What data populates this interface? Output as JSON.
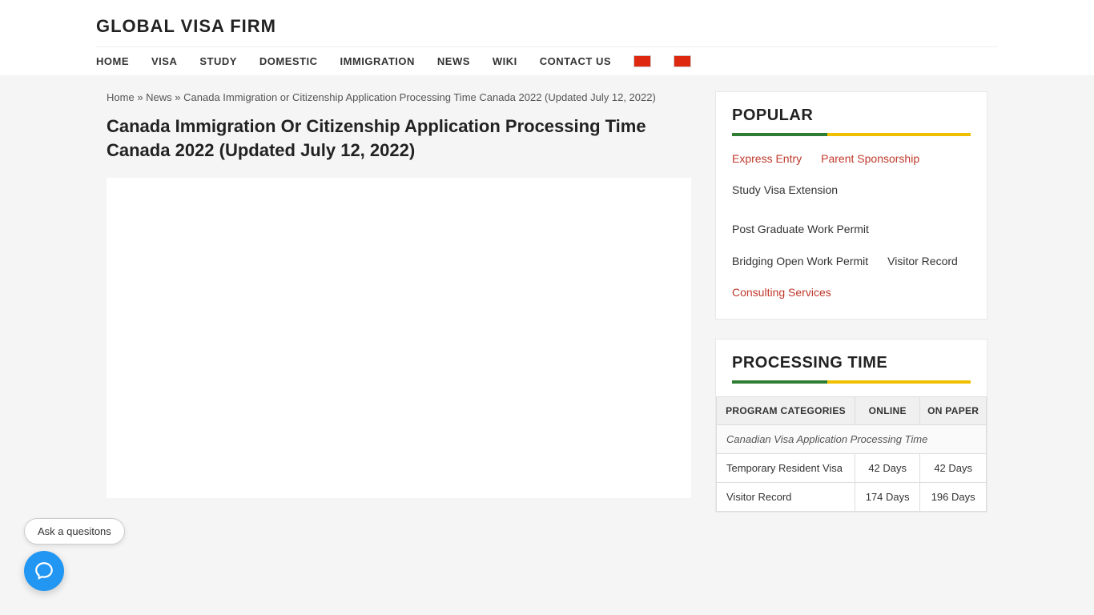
{
  "site": {
    "title": "GLOBAL VISA FIRM"
  },
  "nav": {
    "items": [
      {
        "label": "HOME",
        "href": "#"
      },
      {
        "label": "VISA",
        "href": "#"
      },
      {
        "label": "STUDY",
        "href": "#"
      },
      {
        "label": "DOMESTIC",
        "href": "#"
      },
      {
        "label": "IMMIGRATION",
        "href": "#"
      },
      {
        "label": "NEWS",
        "href": "#"
      },
      {
        "label": "WIKI",
        "href": "#"
      },
      {
        "label": "CONTACT US",
        "href": "#"
      }
    ]
  },
  "breadcrumb": {
    "home": "Home",
    "news": "News",
    "current": "Canada Immigration or Citizenship Application Processing Time Canada 2022 (Updated July 12, 2022)"
  },
  "article": {
    "title": "Canada Immigration Or Citizenship Application Processing Time Canada 2022 (Updated July 12, 2022)"
  },
  "sidebar": {
    "popular": {
      "title": "POPULAR",
      "links": [
        {
          "label": "Express Entry",
          "color": "red"
        },
        {
          "label": "Parent Sponsorship",
          "color": "red"
        },
        {
          "label": "Study Visa Extension",
          "color": "black"
        },
        {
          "label": "Post Graduate Work Permit",
          "color": "black"
        },
        {
          "label": "Bridging Open Work Permit",
          "color": "black"
        },
        {
          "label": "Visitor Record",
          "color": "black"
        },
        {
          "label": "Consulting Services",
          "color": "red"
        }
      ]
    },
    "processingTime": {
      "title": "PROCESSING TIME",
      "table": {
        "headers": [
          "PROGRAM CATEGORIES",
          "ONLINE",
          "ON PAPER"
        ],
        "spanRow": "Canadian Visa Application Processing Time",
        "rows": [
          [
            "Temporary Resident Visa",
            "42 Days",
            "42 Days"
          ],
          [
            "Visitor Record",
            "174 Days",
            "196 Days"
          ]
        ]
      }
    }
  },
  "chat": {
    "label": "Ask a quesitons"
  }
}
